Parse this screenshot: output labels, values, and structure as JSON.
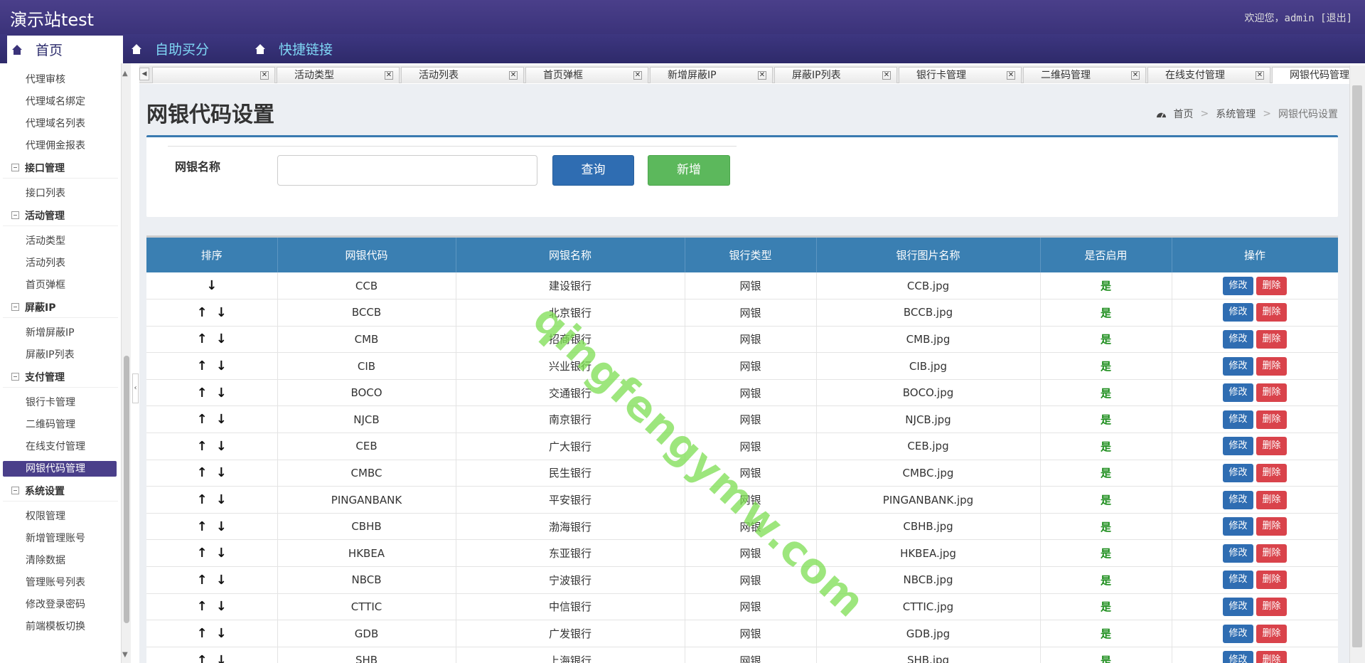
{
  "app": {
    "brand": "演示站test",
    "welcome_prefix": "欢迎您，admin",
    "logout_label": "[退出]"
  },
  "nav": {
    "items": [
      {
        "label": "首页"
      },
      {
        "label": "自助买分"
      },
      {
        "label": "快捷链接"
      }
    ]
  },
  "sidebar": {
    "top_items": [
      "代理审核",
      "代理域名绑定",
      "代理域名列表",
      "代理佣金报表"
    ],
    "sections": [
      {
        "title": "接口管理",
        "items": [
          "接口列表"
        ]
      },
      {
        "title": "活动管理",
        "items": [
          "活动类型",
          "活动列表",
          "首页弹框"
        ]
      },
      {
        "title": "屏蔽IP",
        "items": [
          "新增屏蔽IP",
          "屏蔽IP列表"
        ]
      },
      {
        "title": "支付管理",
        "items": [
          "银行卡管理",
          "二维码管理",
          "在线支付管理",
          "网银代码管理"
        ]
      },
      {
        "title": "系统设置",
        "items": [
          "权限管理",
          "新增管理账号",
          "清除数据",
          "管理账号列表",
          "修改登录密码",
          "前端模板切换"
        ]
      }
    ],
    "active_item": "网银代码管理"
  },
  "tabs": [
    "",
    "活动类型",
    "活动列表",
    "首页弹框",
    "新增屏蔽IP",
    "屏蔽IP列表",
    "银行卡管理",
    "二维码管理",
    "在线支付管理",
    "网银代码管理"
  ],
  "tab_close_glyph": "✕",
  "page": {
    "title": "网银代码设置",
    "breadcrumb": [
      "首页",
      "系统管理",
      "网银代码设置"
    ],
    "breadcrumb_sep": ">"
  },
  "search": {
    "label": "网银名称",
    "input_value": "",
    "query_button": "查询",
    "add_button": "新增"
  },
  "table": {
    "columns": [
      "排序",
      "网银代码",
      "网银名称",
      "银行类型",
      "银行图片名称",
      "是否启用",
      "操作"
    ],
    "edit_label": "修改",
    "delete_label": "删除",
    "up_arrow": "↑",
    "down_arrow": "↓",
    "rows": [
      {
        "code": "CCB",
        "name": "建设银行",
        "type": "网银",
        "image": "CCB.jpg",
        "enabled": "是",
        "first": true
      },
      {
        "code": "BCCB",
        "name": "北京银行",
        "type": "网银",
        "image": "BCCB.jpg",
        "enabled": "是"
      },
      {
        "code": "CMB",
        "name": "招商银行",
        "type": "网银",
        "image": "CMB.jpg",
        "enabled": "是"
      },
      {
        "code": "CIB",
        "name": "兴业银行",
        "type": "网银",
        "image": "CIB.jpg",
        "enabled": "是"
      },
      {
        "code": "BOCO",
        "name": "交通银行",
        "type": "网银",
        "image": "BOCO.jpg",
        "enabled": "是"
      },
      {
        "code": "NJCB",
        "name": "南京银行",
        "type": "网银",
        "image": "NJCB.jpg",
        "enabled": "是"
      },
      {
        "code": "CEB",
        "name": "广大银行",
        "type": "网银",
        "image": "CEB.jpg",
        "enabled": "是"
      },
      {
        "code": "CMBC",
        "name": "民生银行",
        "type": "网银",
        "image": "CMBC.jpg",
        "enabled": "是"
      },
      {
        "code": "PINGANBANK",
        "name": "平安银行",
        "type": "网银",
        "image": "PINGANBANK.jpg",
        "enabled": "是"
      },
      {
        "code": "CBHB",
        "name": "渤海银行",
        "type": "网银",
        "image": "CBHB.jpg",
        "enabled": "是"
      },
      {
        "code": "HKBEA",
        "name": "东亚银行",
        "type": "网银",
        "image": "HKBEA.jpg",
        "enabled": "是"
      },
      {
        "code": "NBCB",
        "name": "宁波银行",
        "type": "网银",
        "image": "NBCB.jpg",
        "enabled": "是"
      },
      {
        "code": "CTTIC",
        "name": "中信银行",
        "type": "网银",
        "image": "CTTIC.jpg",
        "enabled": "是"
      },
      {
        "code": "GDB",
        "name": "广发银行",
        "type": "网银",
        "image": "GDB.jpg",
        "enabled": "是"
      },
      {
        "code": "SHB",
        "name": "上海银行",
        "type": "网银",
        "image": "SHB.jpg",
        "enabled": "是"
      }
    ]
  },
  "watermark": "qingfengymw.com",
  "colors": {
    "header": "#3b337a",
    "table_header": "#3a7fb2",
    "primary_button": "#2f6db2",
    "add_button": "#5cb85c",
    "delete_button": "#d9434b",
    "enabled_text": "#1a8c1a"
  }
}
